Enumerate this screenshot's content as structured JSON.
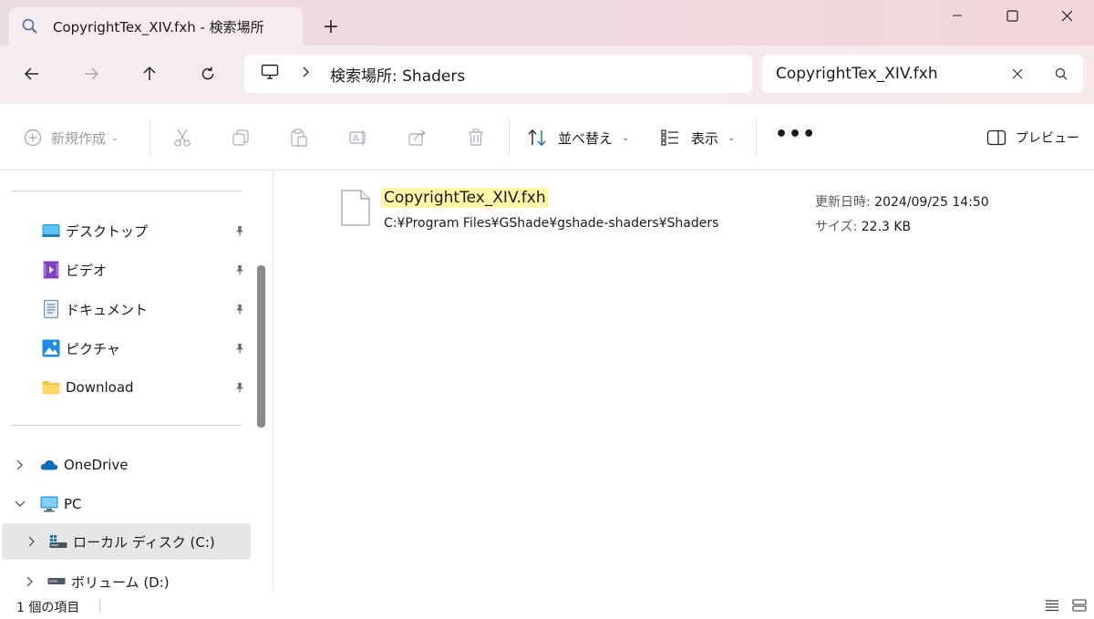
{
  "window": {
    "tab_title": "CopyrightTex_XIV.fxh - 検索場所",
    "new_tab": "+"
  },
  "nav": {
    "breadcrumb": "検索場所: Shaders",
    "search_value": "CopyrightTex_XIV.fxh"
  },
  "toolbar": {
    "new_label": "新規作成",
    "sort_label": "並べ替え",
    "view_label": "表示",
    "more_label": "•••",
    "preview_label": "プレビュー"
  },
  "sidebar": {
    "items": [
      {
        "label": "デスクトップ",
        "icon": "desktop-icon",
        "pinned": true
      },
      {
        "label": "ビデオ",
        "icon": "video-icon",
        "pinned": true
      },
      {
        "label": "ドキュメント",
        "icon": "document-icon",
        "pinned": true
      },
      {
        "label": "ピクチャ",
        "icon": "picture-icon",
        "pinned": true
      },
      {
        "label": "Download",
        "icon": "folder-icon",
        "pinned": true
      },
      {
        "label": "OneDrive",
        "icon": "cloud-icon",
        "expand": ">"
      },
      {
        "label": "PC",
        "icon": "pc-icon",
        "expand": "v"
      },
      {
        "label": "ローカル ディスク (C:)",
        "icon": "drive-icon",
        "expand": ">",
        "selected": true
      },
      {
        "label": "ボリューム (D:)",
        "icon": "drive-icon",
        "expand": ">"
      }
    ]
  },
  "result": {
    "file_name": "CopyrightTex_XIV.fxh",
    "path": "C:¥Program Files¥GShade¥gshade-shaders¥Shaders",
    "modified_label": "更新日時:",
    "modified_value": "2024/09/25 14:50",
    "size_label": "サイズ:",
    "size_value": "22.3 KB"
  },
  "status": {
    "item_count": "1 個の項目"
  },
  "colors": {
    "highlight": "#fff7a8",
    "selected_bg": "#e6e6e6",
    "accent_blue": "#0f6cbd"
  }
}
